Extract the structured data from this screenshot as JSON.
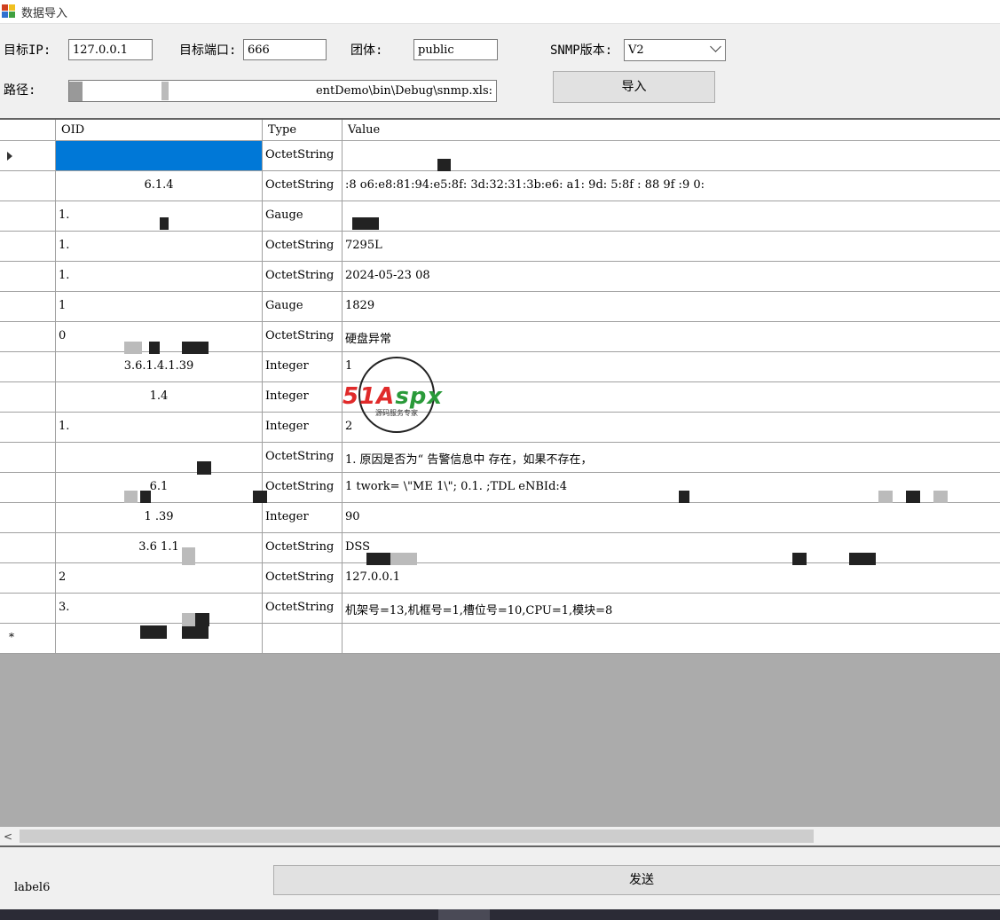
{
  "window": {
    "title": "数据导入"
  },
  "form": {
    "ip_label": "目标IP:",
    "ip_value": "127.0.0.1",
    "port_label": "目标端口:",
    "port_value": "666",
    "community_label": "团体:",
    "community_value": "public",
    "snmp_label": "SNMP版本:",
    "snmp_value": "V2",
    "path_label": "路径:",
    "path_value": ".entDemo\\bin\\Debug\\snmp.xls:",
    "import_button": "导入"
  },
  "grid": {
    "columns": [
      "OID",
      "Type",
      "Value"
    ],
    "rows": [
      {
        "oid": "",
        "type": "OctetString",
        "value": ""
      },
      {
        "oid": "6.1.4",
        "type": "OctetString",
        "value": ":8  o6:e8:81:94:e5:8f:   3d:32:31:3b:e6:   a1:   9d:   5:8f   :  88         9f    :9    0:"
      },
      {
        "oid": "1.",
        "type": "Gauge",
        "value": ""
      },
      {
        "oid": "1.",
        "type": "OctetString",
        "value": "7295L"
      },
      {
        "oid": "1.",
        "type": "OctetString",
        "value": "2024-05-23        08"
      },
      {
        "oid": "1",
        "type": "Gauge",
        "value": "1829"
      },
      {
        "oid": "0",
        "type": "OctetString",
        "value": "硬盘异常"
      },
      {
        "oid": "3.6.1.4.1.39",
        "type": "Integer",
        "value": "1"
      },
      {
        "oid": "1.4",
        "type": "Integer",
        "value": ""
      },
      {
        "oid": "1.",
        "type": "Integer",
        "value": "2"
      },
      {
        "oid": "",
        "type": "OctetString",
        "value": "1.          原因是否为“           告警信息中              存在，如果不存在，"
      },
      {
        "oid": "6.1",
        "type": "OctetString",
        "value": "1                  twork=      \\\"ME    1\\\";   0.1.   ;TDL eNBId:4"
      },
      {
        "oid": "1   .39",
        "type": "Integer",
        "value": "90"
      },
      {
        "oid": "3.6   1.1",
        "type": "OctetString",
        "value": "DSS"
      },
      {
        "oid": "2",
        "type": "OctetString",
        "value": "127.0.0.1"
      },
      {
        "oid": "3.",
        "type": "OctetString",
        "value": "机架号=13,机框号=1,槽位号=10,CPU=1,模块=8"
      }
    ]
  },
  "footer": {
    "status_label": "label6",
    "send_button": "发送"
  },
  "watermark": {
    "brand": "51Aspx",
    "tagline": "源码服务专家"
  }
}
